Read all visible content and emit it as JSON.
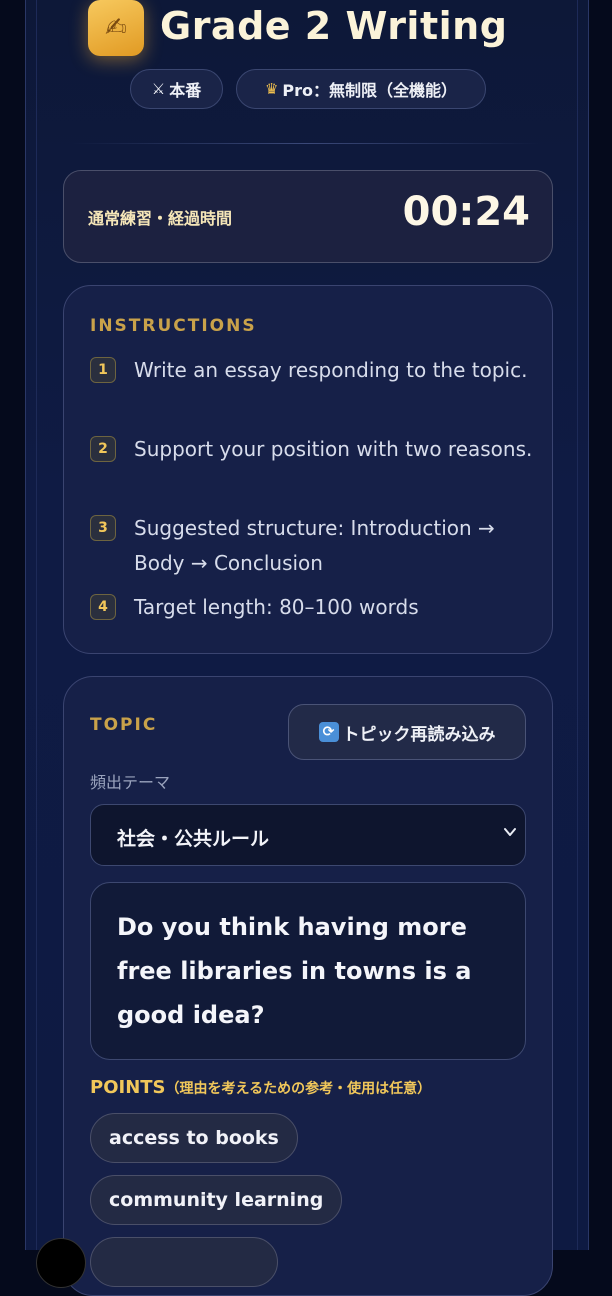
{
  "header": {
    "app_icon": "writing-hand-icon",
    "title": "Grade 2 Writing",
    "mode_icon": "crossed-swords-icon",
    "mode_label": "本番",
    "plan_icon": "crown-icon",
    "plan_label": "Pro：無制限（全機能）"
  },
  "timer": {
    "label": "通常練習・経過時間",
    "value": "00:24"
  },
  "instructions": {
    "heading": "INSTRUCTIONS",
    "items": [
      {
        "num": "1",
        "text": "Write an essay responding to the topic."
      },
      {
        "num": "2",
        "text": "Support your position with two reasons."
      },
      {
        "num": "3",
        "text": "Suggested structure: Introduction → Body → Conclusion"
      },
      {
        "num": "4",
        "text": "Target length: 80–100 words"
      }
    ]
  },
  "topic": {
    "heading": "TOPIC",
    "reload_icon": "reload-icon",
    "reload_label": "トピック再読み込み",
    "theme_caption": "頻出テーマ",
    "theme_selected": "社会・公共ルール",
    "question": "Do you think having more free libraries in towns is a good idea?",
    "points_heading": "POINTS",
    "points_note": "（理由を考えるための参考・使用は任意）",
    "points": [
      "access to books",
      "community learning",
      ""
    ]
  },
  "colors": {
    "accent_gold": "#f1c75a",
    "background": "#0f1b44"
  }
}
